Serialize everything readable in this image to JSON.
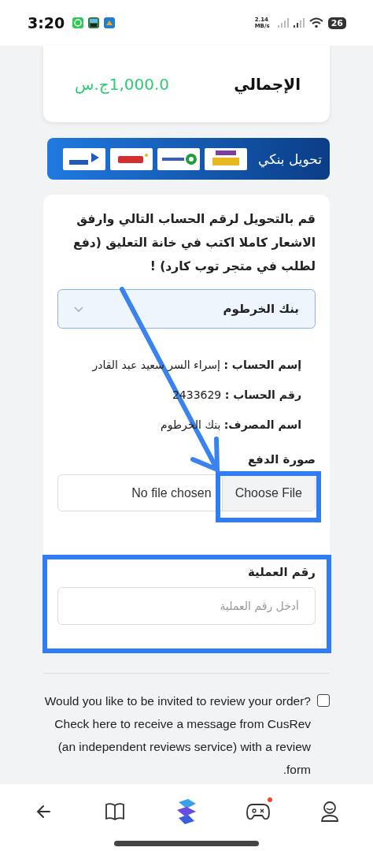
{
  "status_bar": {
    "time": "3:20",
    "speed_value": "2.14",
    "speed_unit": "MB/s",
    "battery": "26"
  },
  "total": {
    "label": "الإجمالي",
    "amount": "1,000.0ج.س"
  },
  "payment_method": {
    "title": "تحويل بنكي"
  },
  "transfer": {
    "instructions": "قم بالتحويل لرقم الحساب التالي وارفق الاشعار كاملا اكتب في خانة التعليق (دفع لطلب في متجر توب كارد) !",
    "bank_select": {
      "value": "بنك الخرطوم"
    },
    "details": [
      "**إسم الحساب :** إسراء السر سعيد عبد القادر",
      "**رقم الحساب :** 2433629",
      "**اسم المصرف:** بنك الخرطوم"
    ],
    "receipt": {
      "label": "صورة الدفع",
      "button": "Choose File",
      "status": "No file chosen"
    },
    "transaction": {
      "label": "رقم العملية",
      "placeholder": "أدخل رقم العملية"
    }
  },
  "review_optin": {
    "checked": false,
    "text": "Would you like to be invited to review your order? Check here to receive a message from CusRev (an independent reviews service) with a review form."
  },
  "bottom_nav": [
    {
      "kind": "back",
      "badge": false
    },
    {
      "kind": "book",
      "badge": false
    },
    {
      "kind": "logo",
      "badge": false
    },
    {
      "kind": "game",
      "badge": true
    },
    {
      "kind": "profile",
      "badge": false
    }
  ]
}
